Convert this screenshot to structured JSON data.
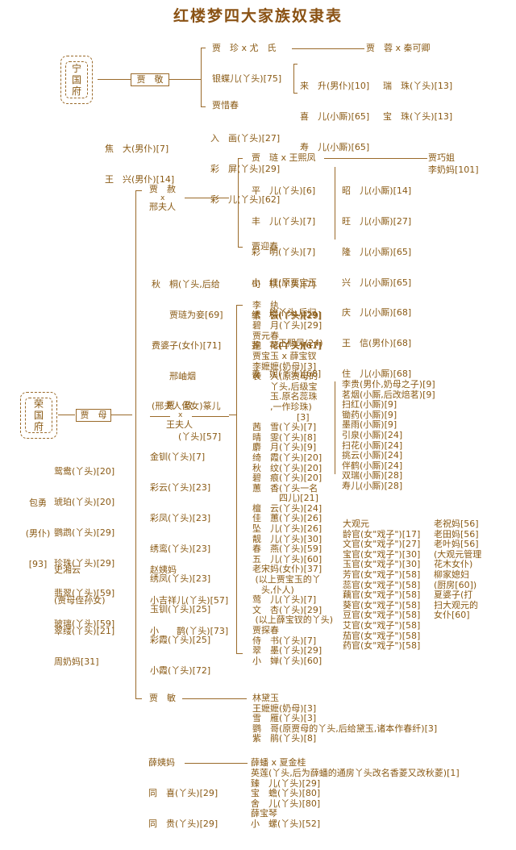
{
  "title": "红楼梦四大家族奴隶表",
  "ningguo": {
    "seal": [
      "宁",
      "国",
      "府"
    ],
    "head": "贾　敬",
    "jiazhen": "贾　珍 x 尤　氏",
    "jiarong": "贾　蓉 x 秦可卿",
    "yindier": "银蝶儿(丫头)[75]",
    "servants_col1": [
      "来　升(男仆)[10]",
      "喜　儿(小厮)[65]",
      "寿　儿(小厮)[65]"
    ],
    "servants_col2": [
      "瑞　珠(丫头)[13]",
      "宝　珠(丫头)[13]"
    ],
    "jiaxichun": "贾惜春",
    "xichun_maids": [
      "入　画(丫头)[27]",
      "彩　屏(丫头)[29]",
      "彩　儿(丫头)[62]"
    ],
    "male_servants": [
      "焦　大(男仆)[7]",
      "王　兴(男仆)[14]"
    ]
  },
  "rongguo": {
    "seal": [
      "荣",
      "国",
      "府"
    ],
    "head": "贾　母",
    "jiamu_maids": [
      "鸳鸯(丫头)[20]",
      "琥珀(丫头)[20]",
      "鹦鹉(丫头)[29]",
      "珍珠(丫头)[29]",
      "翡翠(丫头)[59]",
      "玻璃(丫头)[59]"
    ],
    "baoyong": [
      "包勇",
      "(男仆)",
      "[93]"
    ],
    "xiangyun": [
      "史湘云",
      "(贾母侄孙女)",
      "翠缕(丫头)[21]",
      "周奶妈[31]"
    ],
    "jiashe": {
      "name": "贾　赦",
      "x": "x",
      "spouse": "邢夫人",
      "jialian": "贾　琏 x 王熙凤",
      "qiaojie": "贾巧姐",
      "qiaojie_nurse": "李奶妈[101]",
      "lian_maids": [
        "平　儿(丫头)[6]",
        "丰　儿(丫头)[7]",
        "彩　明(丫头)[7]",
        "小　红(原贾宝玉",
        "　　的丫头,后归",
        "　　　王熙凤(24)",
        "善　姐(丫头)[68]"
      ],
      "lian_boys": [
        "昭　儿(小厮)[14]",
        "旺　儿(小厮)[27]",
        "隆　儿(小厮)[65]",
        "兴　儿(小厮)[65]",
        "庆　儿(小厮)[68]",
        "王　信(男仆)[68]",
        "住　儿(小厮)[68]"
      ],
      "jiayingchun": "贾迎春",
      "yingchun_maids": [
        "司　棋(丫头)[7]",
        "绣　橘(丫头)[29]",
        "莲　花(丫头)[61]"
      ],
      "she_servants": [
        "秋　桐(丫头,后给",
        "　　贾琏为妾[69]",
        "费婆子(女仆)[71]",
        "　　邢岫烟",
        "(邢夫人侄女)篆儿",
        "　　　(丫头)[57]"
      ]
    },
    "jiazheng": {
      "name": "贾　政",
      "x": "x",
      "spouse": "王夫人",
      "wang_maids": [
        "金钏(丫头)[7]",
        "彩云(丫头)[23]",
        "彩凤(丫头)[23]",
        "绣鸾(丫头)[23]",
        "绣凤(丫头)[23]",
        "玉钏(丫头)[25]",
        "彩霞(丫头)[25]",
        "小霞(丫头)[72]"
      ],
      "zhao": [
        "赵姨妈",
        "小吉祥儿(丫头)[57]",
        "小　　鹊(丫头)[73]"
      ],
      "children_col": [
        "李　纨",
        "素　云(丫头)[29]",
        "碧　月(丫头)[29]",
        "贾元春",
        "抱　琴(丫头)[17]",
        "贾宝玉 x 薛宝钗",
        "李嬷嬷(奶母)[3]",
        "袭　人(原贾母的",
        "　　丫头,后级宝",
        "　　玉.原名蕊珠",
        "　　,一作珍珠)",
        "　　　　　[3]",
        "茜　雪(丫头)[7]",
        "晴　雯(丫头)[8]",
        "麝　月(丫头)[9]",
        "绮　霞(丫头)[20]",
        "秋　纹(丫头)[20]",
        "碧　痕(丫头)[20]",
        "蕙　香(丫头一名",
        "　　　四儿)[21]",
        "檀　云(丫头)[24]",
        "佳　蕙(丫头)[26]",
        "坠　儿(丫头)[26]",
        "靓　儿(丫头)[30]",
        "春　燕(丫头)[59]",
        "五　儿(丫头)[60]",
        "老宋妈(女仆)[37]",
        " (以上贾宝玉的丫",
        "　头,仆人)",
        "莺　儿(丫头)[7]",
        "文　杏(丫头)[29]",
        " (以上薛宝钗的丫头)",
        "贾探春",
        "侍　书(丫头)[7]",
        "翠　墨(丫头)[29]",
        "小　婵(丫头)[60]"
      ],
      "baoyu_boys": [
        "李贵(男仆,奶母之子)[9]",
        "茗烟(小厮,后改焙茗)[9]",
        "扫红(小厮)[9]",
        "锄药(小厮)[9]",
        "墨雨(小厮)[9]",
        "引泉(小厮)[24]",
        "扫花(小厮)[24]",
        "挑云(小厮)[24]",
        "伴鹤(小厮)[24]",
        "双瑞(小厮)[28]",
        "寿儿(小厮)[28]"
      ],
      "daguanyuan": [
        "大观元",
        "龄官(女\"戏子\")[17]",
        "文官(女\"戏子\")[27]",
        "宝官(女\"戏子\")[30]",
        "玉官(女\"戏子\")[30]",
        "芳官(女\"戏子\")[58]",
        "蕊官(女\"戏子\")[58]",
        "藕官(女\"戏子\")[58]",
        "葵官(女\"戏子\")[58]",
        "豆官(女\"戏子\")[58]",
        "艾官(女\"戏子\")[58]",
        "茄官(女\"戏子\")[58]",
        "药官(女\"戏子\")[58]"
      ],
      "garden_staff": [
        "老祝妈[56]",
        "老田妈[56]",
        "老叶妈[56]",
        "(大观元管理",
        "花木女仆)",
        "柳家媳妇",
        "(厨房[60])",
        "夏婆子(打",
        "扫大观元的",
        "女仆[60]"
      ]
    },
    "jiamin": {
      "name": "贾　敏",
      "daiyu": [
        "林黛玉",
        "王嬷嬷(奶母)[3]",
        "雪　雁(丫头)[3]",
        "鹦　哥(原贾母的丫头,后给黛玉,诸本作春纤)[3]",
        "紫　鹃(丫头)[8]"
      ]
    }
  },
  "xue": {
    "head": "薛姨妈",
    "head_servants": [
      "同　喜(丫头)[29]",
      "同　贵(丫头)[29]"
    ],
    "xuepan": "薛蟠 x 夏金桂",
    "pan_servants": [
      "英莲(丫头,后为薛蟠的通房丫头改名香菱又改秋菱)[1]",
      "臻　儿(丫头)[29]",
      "宝　蟾(丫头)[80]",
      "舍　儿(丫头)[80]",
      "薛宝琴",
      "小　螺(丫头)[52]"
    ]
  },
  "colors": {
    "text": "#8a5a14",
    "line": "#9a6a2a",
    "title": "#8a5214"
  }
}
